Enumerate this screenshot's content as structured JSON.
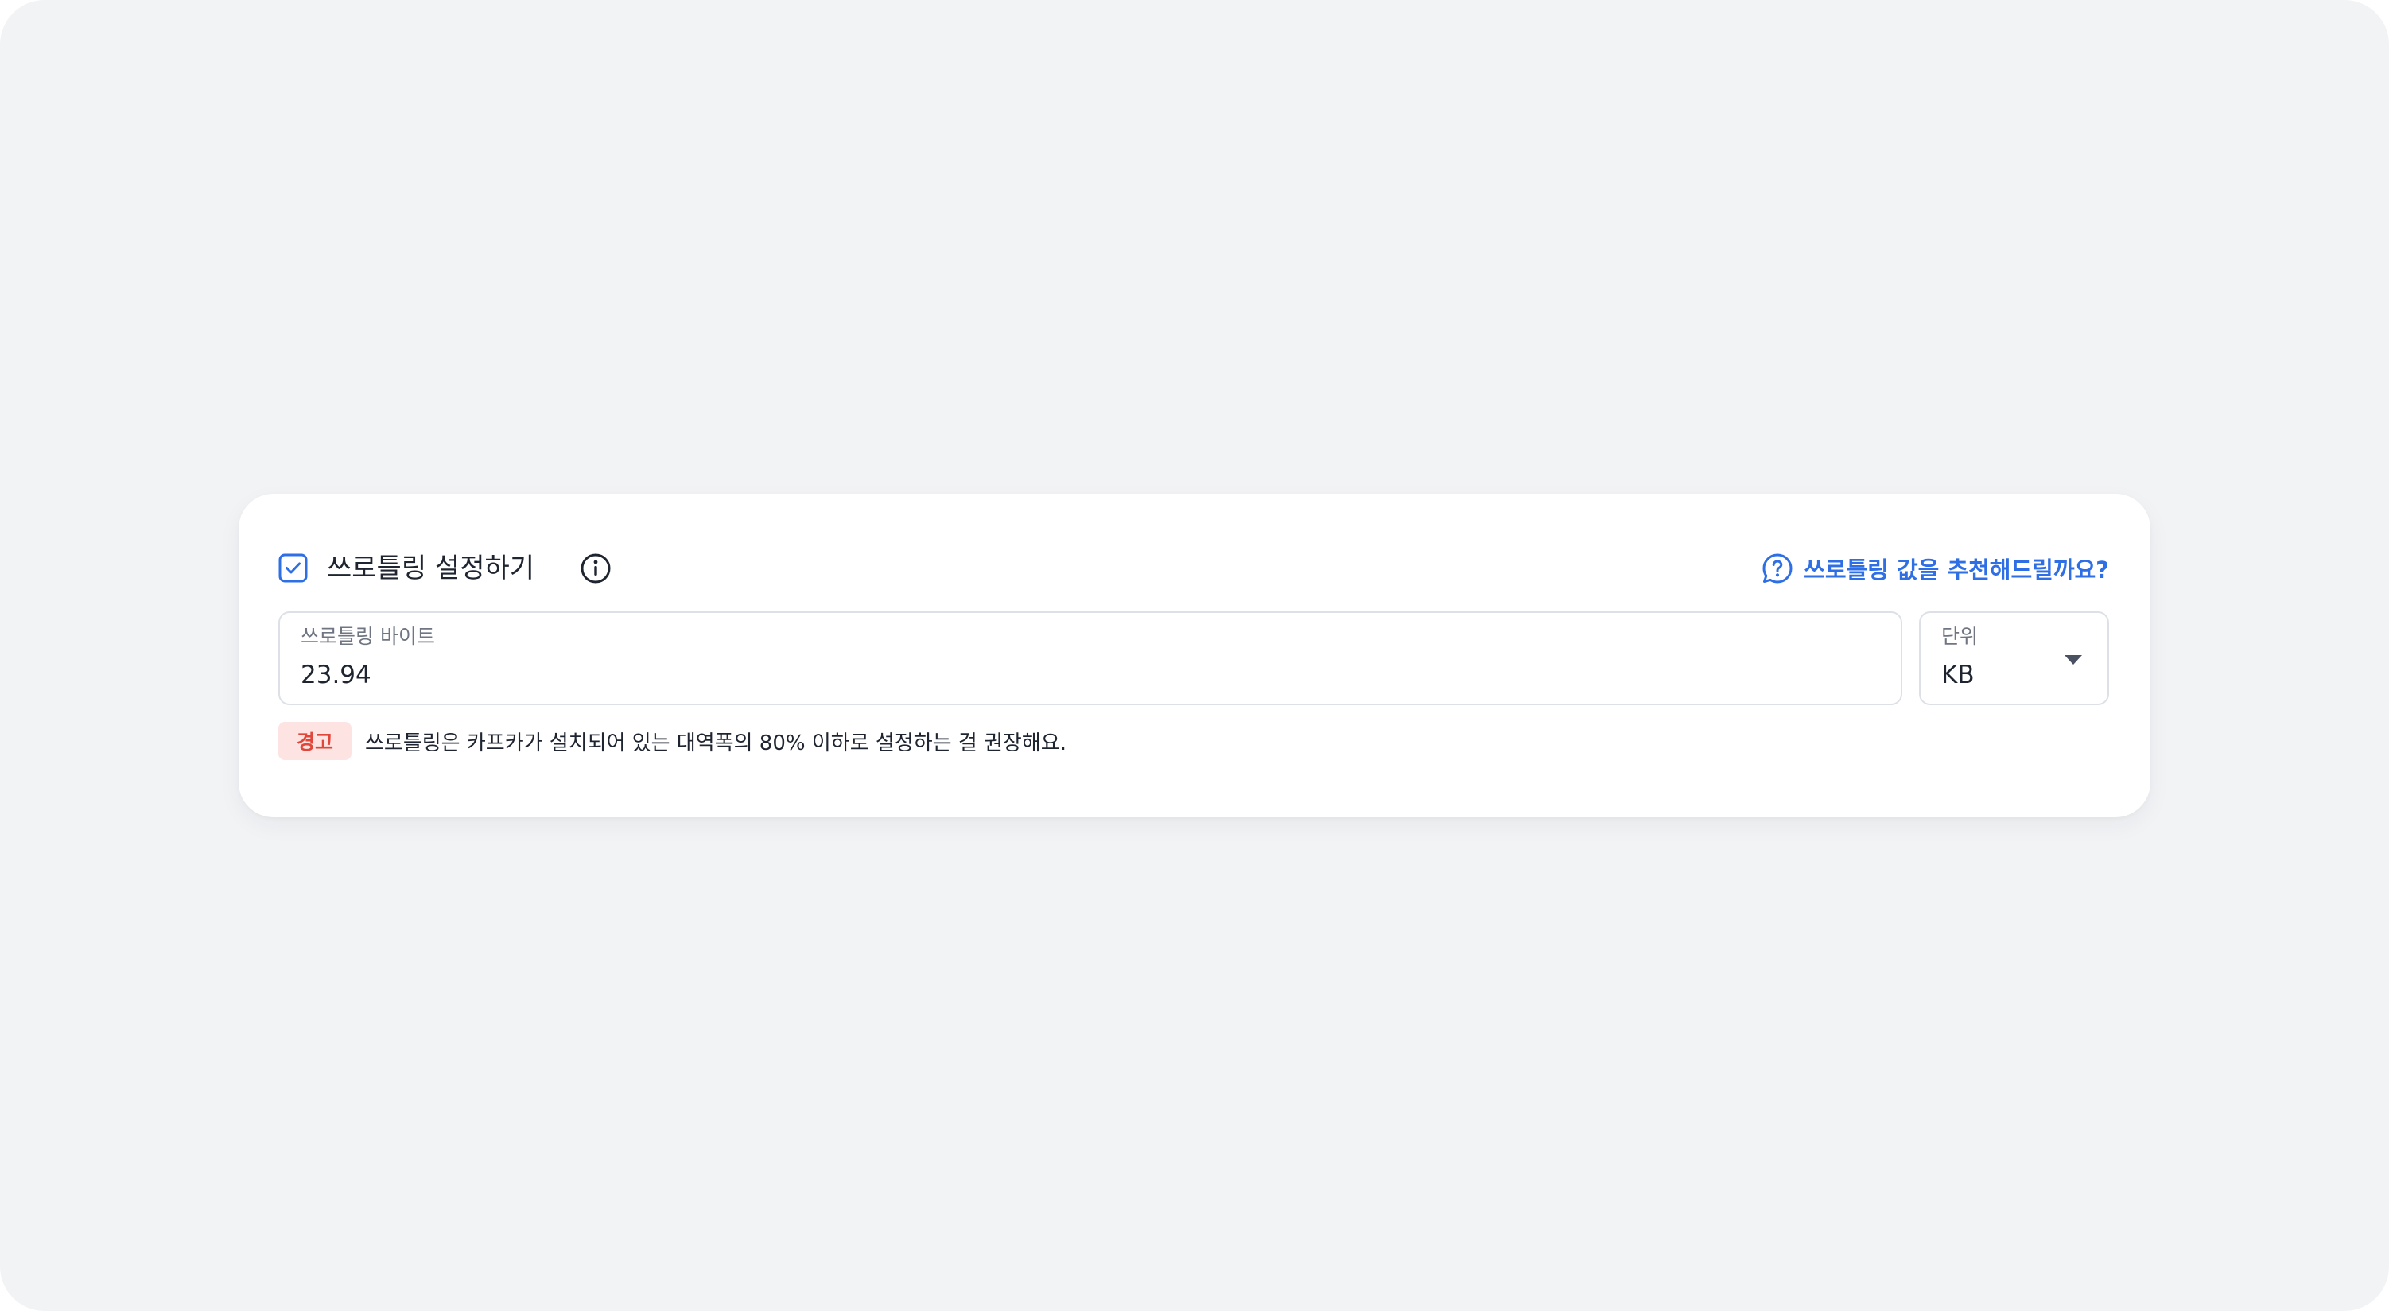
{
  "throttle": {
    "enabled": true,
    "title": "쓰로틀링 설정하기",
    "recommend_link": "쓰로틀링 값을 추천해드릴까요?",
    "bytes_field": {
      "label": "쓰로틀링 바이트",
      "value": "23.94"
    },
    "unit_field": {
      "label": "단위",
      "value": "KB"
    },
    "warning": {
      "badge": "경고",
      "message": "쓰로틀링은 카프카가 설치되어 있는 대역폭의 80% 이하로 설정하는 걸 권장해요."
    }
  },
  "icons": {
    "checkbox": "checkbox-checked-icon",
    "info": "info-circle-icon",
    "recommend": "chat-question-icon",
    "dropdown": "caret-down-icon"
  },
  "colors": {
    "accent": "#2f6fe6",
    "warning_text": "#e0473a",
    "warning_bg": "#fde4e2",
    "page_bg": "#f2f3f5",
    "card_bg": "#ffffff",
    "border": "#dde1e7"
  }
}
